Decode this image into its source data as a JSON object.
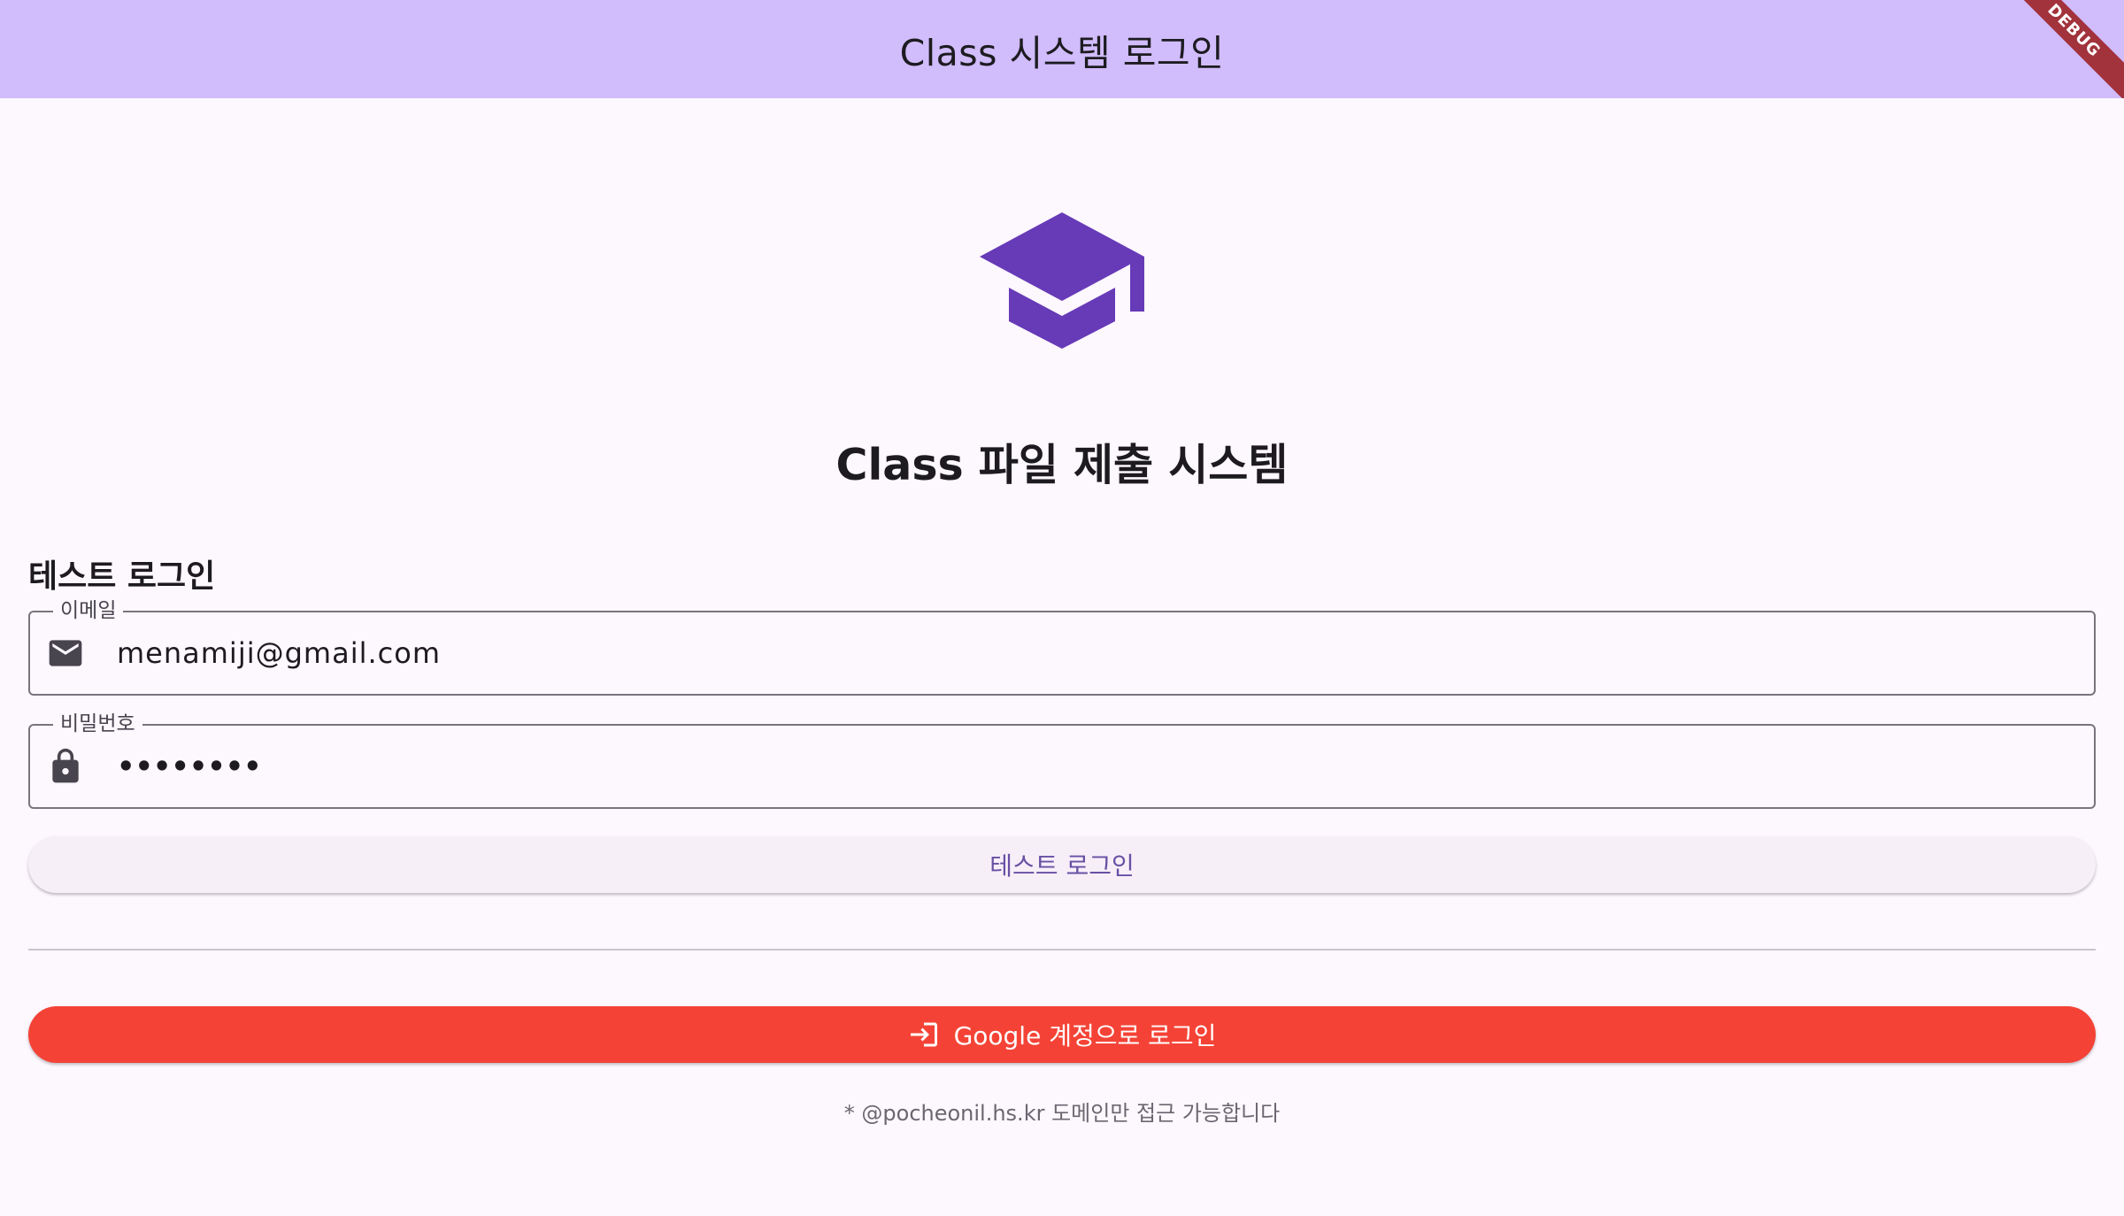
{
  "appbar": {
    "title": "Class 시스템 로그인",
    "debug_banner": "DEBUG",
    "background": "#d1bcfc"
  },
  "logo": {
    "icon": "graduation-cap-icon",
    "color": "#673ab7"
  },
  "page_title": "Class 파일 제출 시스템",
  "test_login": {
    "heading": "테스트 로그인",
    "email": {
      "label": "이메일",
      "icon": "email-icon",
      "value": "menamiji@gmail.com"
    },
    "password": {
      "label": "비밀번호",
      "icon": "lock-icon",
      "masked_value": "••••••••"
    },
    "button_label": "테스트 로그인"
  },
  "google_login": {
    "icon": "login-icon",
    "button_label": "Google 계정으로 로그인",
    "color": "#f44336"
  },
  "note": "* @pocheonil.hs.kr 도메인만 접근 가능합니다"
}
